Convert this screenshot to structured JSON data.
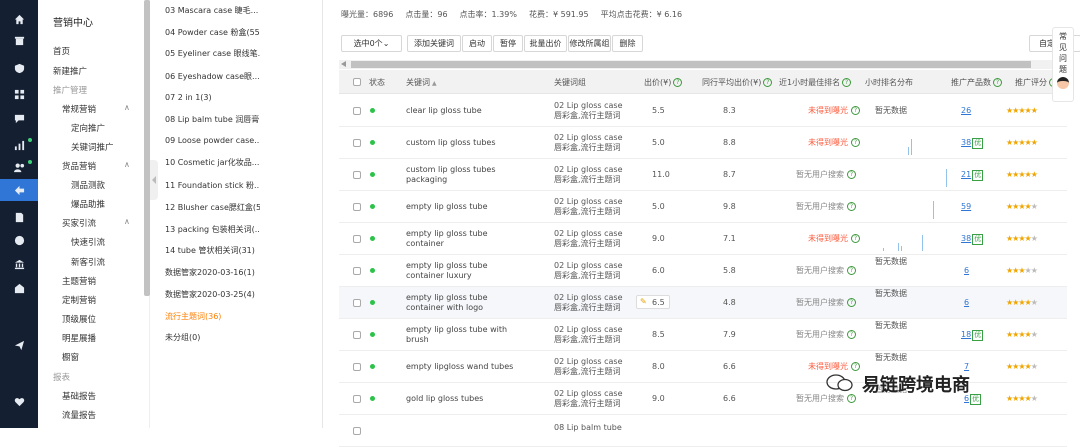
{
  "rail": {
    "icons": [
      "home-icon",
      "shop-icon",
      "shield-icon",
      "grid-icon",
      "message-icon",
      "bar-chart-icon",
      "users-icon",
      "share-icon",
      "document-icon",
      "globe-icon",
      "bank-icon",
      "building-icon",
      "send-icon",
      "heart-icon"
    ]
  },
  "menu": {
    "title": "营销中心",
    "items": [
      {
        "label": "首页",
        "level": 0
      },
      {
        "label": "新建推广",
        "level": 0
      },
      {
        "label": "推广管理",
        "level": 0,
        "group": true
      },
      {
        "label": "常规营销",
        "level": 1,
        "caret": "∧"
      },
      {
        "label": "定向推广",
        "level": 2
      },
      {
        "label": "关键词推广",
        "level": 2
      },
      {
        "label": "货品营销",
        "level": 1,
        "caret": "∧"
      },
      {
        "label": "测品测款",
        "level": 2
      },
      {
        "label": "爆品助推",
        "level": 2
      },
      {
        "label": "买家引流",
        "level": 1,
        "caret": "∧"
      },
      {
        "label": "快速引流",
        "level": 2
      },
      {
        "label": "新客引流",
        "level": 2
      },
      {
        "label": "主题营销",
        "level": 1
      },
      {
        "label": "定制营销",
        "level": 1
      },
      {
        "label": "顶级展位",
        "level": 1
      },
      {
        "label": "明星展播",
        "level": 1
      },
      {
        "label": "橱窗",
        "level": 1
      },
      {
        "label": "报表",
        "level": 0,
        "group": true
      },
      {
        "label": "基础报告",
        "level": 1
      },
      {
        "label": "流量报告",
        "level": 1
      }
    ]
  },
  "groups": [
    "03 Mascara case 睫毛...",
    "04 Powder case 粉盒(55)",
    "05 Eyeliner case 眼线笔...",
    "06 Eyeshadow case眼...",
    "07 2 in 1(3)",
    "08 Lip balm tube 润唇膏...",
    "09 Loose powder case...",
    "10 Cosmetic jar化妆品...",
    "11 Foundation stick 粉...",
    "12 Blusher case腮红盒(5)",
    "13 packing 包装相关词(...",
    "14 tube 管状相关词(31)",
    "数据管家2020-03-16(1)",
    "数据管家2020-03-25(4)",
    "流行主题词(36)",
    "未分组(0)"
  ],
  "active_group": 14,
  "stats": [
    "曝光量：6896",
    "点击量：96",
    "点击率：1.39%",
    "花费：¥ 591.95",
    "平均点击花费：¥ 6.16"
  ],
  "toolbar": {
    "select": "选中0个",
    "buttons": [
      "添加关键词",
      "启动",
      "暂停",
      "批量出价",
      "修改所属组",
      "删除"
    ],
    "custom": "自定义列"
  },
  "headers": {
    "status": "状态",
    "keyword": "关键词",
    "sort_mark": "▲",
    "group": "关键词组",
    "bid": "出价(¥)",
    "avg_bid": "同行平均出价(¥)",
    "best_rank": "近1小时最佳排名",
    "hour_dist": "小时排名分布",
    "products": "推广产品数",
    "rating": "推广评分"
  },
  "rows": [
    {
      "keyword": [
        "clear lip gloss tube"
      ],
      "group": [
        "02 Lip gloss case",
        "唇彩盒,流行主题词"
      ],
      "bid": "5.5",
      "avg": "8.3",
      "rank": "未得到曝光",
      "rank_red": true,
      "dist_text": "暂无数据",
      "products": "26",
      "tag": "",
      "stars": 5,
      "spark": []
    },
    {
      "keyword": [
        "custom lip gloss tubes"
      ],
      "group": [
        "02 Lip gloss case",
        "唇彩盒,流行主题词"
      ],
      "bid": "5.0",
      "avg": "8.8",
      "rank": "未得到曝光",
      "rank_red": true,
      "dist_text": "",
      "products": "38",
      "tag": "优",
      "stars": 5,
      "spark": [
        8,
        16
      ]
    },
    {
      "keyword": [
        "custom lip gloss tubes",
        "packaging"
      ],
      "group": [
        "02 Lip gloss case",
        "唇彩盒,流行主题词"
      ],
      "bid": "11.0",
      "avg": "8.7",
      "rank": "暂无用户搜索",
      "rank_red": false,
      "dist_text": "",
      "products": "21",
      "tag": "优",
      "stars": 5,
      "spark": [
        0,
        0,
        0,
        0,
        0,
        0,
        0,
        0,
        18
      ]
    },
    {
      "keyword": [
        "empty lip gloss tube"
      ],
      "group": [
        "02 Lip gloss case",
        "唇彩盒,流行主题词"
      ],
      "bid": "5.0",
      "avg": "9.8",
      "rank": "暂无用户搜索",
      "rank_red": false,
      "dist_text": "",
      "products": "59",
      "tag": "",
      "stars": 4,
      "spark": [
        0,
        0,
        0,
        0,
        0,
        0,
        0,
        18
      ]
    },
    {
      "keyword": [
        "empty lip gloss tube",
        "container"
      ],
      "group": [
        "02 Lip gloss case",
        "唇彩盒,流行主题词"
      ],
      "bid": "9.0",
      "avg": "7.1",
      "rank": "未得到曝光",
      "rank_red": true,
      "dist_text": "",
      "products": "38",
      "tag": "优",
      "stars": 4,
      "spark": [
        3,
        0,
        0,
        0,
        0,
        8,
        5,
        0,
        0,
        0,
        0,
        0,
        0,
        16
      ]
    },
    {
      "keyword": [
        "empty lip gloss tube",
        "container luxury"
      ],
      "group": [
        "02 Lip gloss case",
        "唇彩盒,流行主题词"
      ],
      "bid": "6.0",
      "avg": "5.8",
      "rank": "暂无用户搜索",
      "rank_red": false,
      "dist_text": "暂无数据",
      "products": "6",
      "tag": "",
      "stars": 3,
      "spark": []
    },
    {
      "keyword": [
        "empty lip gloss tube",
        "container with logo"
      ],
      "group": [
        "02 Lip gloss case",
        "唇彩盒,流行主题词"
      ],
      "bid": "6.5",
      "avg": "4.8",
      "rank": "暂无用户搜索",
      "rank_red": false,
      "dist_text": "暂无数据",
      "products": "6",
      "tag": "",
      "stars": 4,
      "spark": [],
      "edit": true,
      "highlight": true
    },
    {
      "keyword": [
        "empty lip gloss tube with",
        "brush"
      ],
      "group": [
        "02 Lip gloss case",
        "唇彩盒,流行主题词"
      ],
      "bid": "8.5",
      "avg": "7.9",
      "rank": "暂无用户搜索",
      "rank_red": false,
      "dist_text": "暂无数据",
      "products": "18",
      "tag": "优",
      "stars": 4,
      "spark": []
    },
    {
      "keyword": [
        "empty lipgloss wand tubes"
      ],
      "group": [
        "02 Lip gloss case",
        "唇彩盒,流行主题词"
      ],
      "bid": "8.0",
      "avg": "6.6",
      "rank": "未得到曝光",
      "rank_red": true,
      "dist_text": "暂无数据",
      "products": "7",
      "tag": "",
      "stars": 4,
      "spark": []
    },
    {
      "keyword": [
        "gold lip gloss tubes"
      ],
      "group": [
        "02 Lip gloss case",
        "唇彩盒,流行主题词"
      ],
      "bid": "9.0",
      "avg": "6.6",
      "rank": "暂无用户搜索",
      "rank_red": false,
      "dist_text": "暂无数据",
      "products": "6",
      "tag": "优",
      "stars": 4,
      "spark": []
    },
    {
      "keyword": [
        ""
      ],
      "group": [
        "08 Lip balm tube",
        ""
      ],
      "bid": "",
      "avg": "",
      "rank": "",
      "rank_red": false,
      "dist_text": "",
      "products": "",
      "tag": "",
      "stars": 0,
      "spark": []
    }
  ],
  "feedback": {
    "label": "常见问题"
  },
  "watermark": "易链跨境电商",
  "colors": {
    "rail_bg": "#142031",
    "accent": "#2f76d6",
    "active_group": "#ff7f00",
    "danger": "#ff5a3c",
    "ok_green": "#2dc24a",
    "star": "#f0a500"
  }
}
